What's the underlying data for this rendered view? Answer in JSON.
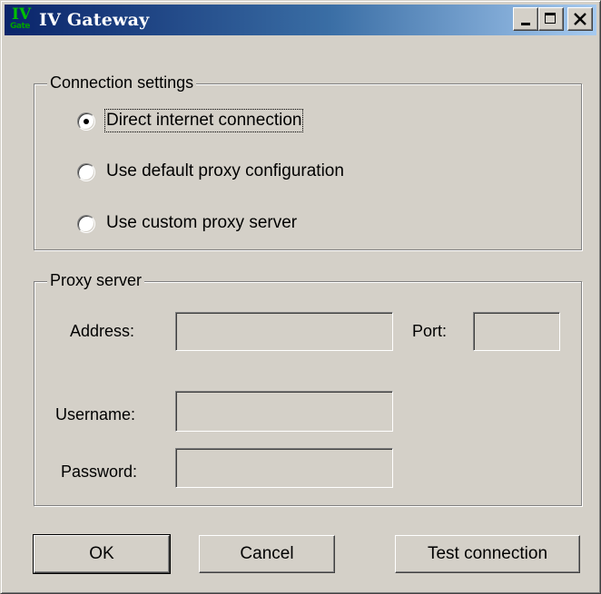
{
  "window": {
    "title": "IV Gateway",
    "icon_text_top": "IV",
    "icon_text_bottom": "Gate"
  },
  "connection_settings": {
    "legend": "Connection settings",
    "options": [
      {
        "label": "Direct internet connection",
        "selected": true
      },
      {
        "label": "Use default proxy configuration",
        "selected": false
      },
      {
        "label": "Use custom proxy server",
        "selected": false
      }
    ]
  },
  "proxy_server": {
    "legend": "Proxy server",
    "address_label": "Address:",
    "address_value": "",
    "port_label": "Port:",
    "port_value": "",
    "username_label": "Username:",
    "username_value": "",
    "password_label": "Password:",
    "password_value": ""
  },
  "buttons": {
    "ok": "OK",
    "cancel": "Cancel",
    "test": "Test connection"
  },
  "colors": {
    "face": "#d4d0c8",
    "title_start": "#0a246a",
    "title_end": "#a6caf0"
  }
}
